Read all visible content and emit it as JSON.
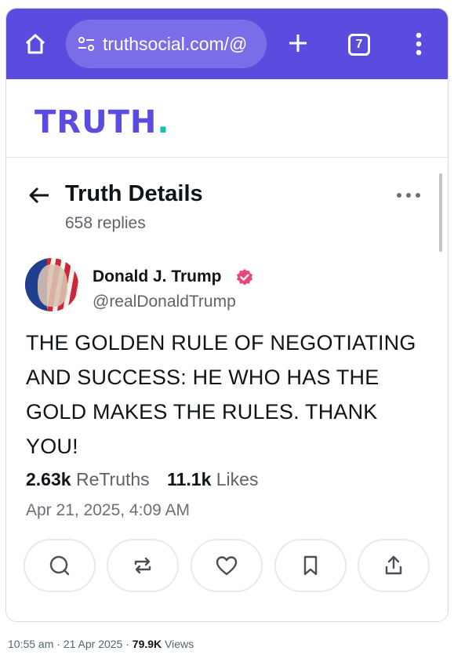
{
  "browser": {
    "url": "truthsocial.com/@",
    "tab_count": "7"
  },
  "brand": {
    "logo_text": "TRUTH",
    "logo_dot": ".",
    "accent_color": "#5b4ce0",
    "dot_color": "#17c4a8"
  },
  "header": {
    "title": "Truth Details",
    "replies": "658 replies"
  },
  "post": {
    "author_name": "Donald J. Trump",
    "handle": "@realDonaldTrump",
    "text": "THE GOLDEN RULE OF NEGOTIATING AND SUCCESS: HE WHO HAS THE GOLD MAKES THE RULES. THANK YOU!",
    "retruths_count": "2.63k",
    "retruths_label": "ReTruths",
    "likes_count": "11.1k",
    "likes_label": "Likes",
    "timestamp": "Apr 21, 2025, 4:09 AM"
  },
  "actions": [
    "reply-icon",
    "retruth-icon",
    "like-icon",
    "bookmark-icon",
    "share-icon"
  ],
  "tweet_meta": {
    "time": "10:55 am",
    "sep1": " · ",
    "date": "21 Apr 2025",
    "sep2": " · ",
    "views_count": "79.9K",
    "views_label": " Views"
  }
}
